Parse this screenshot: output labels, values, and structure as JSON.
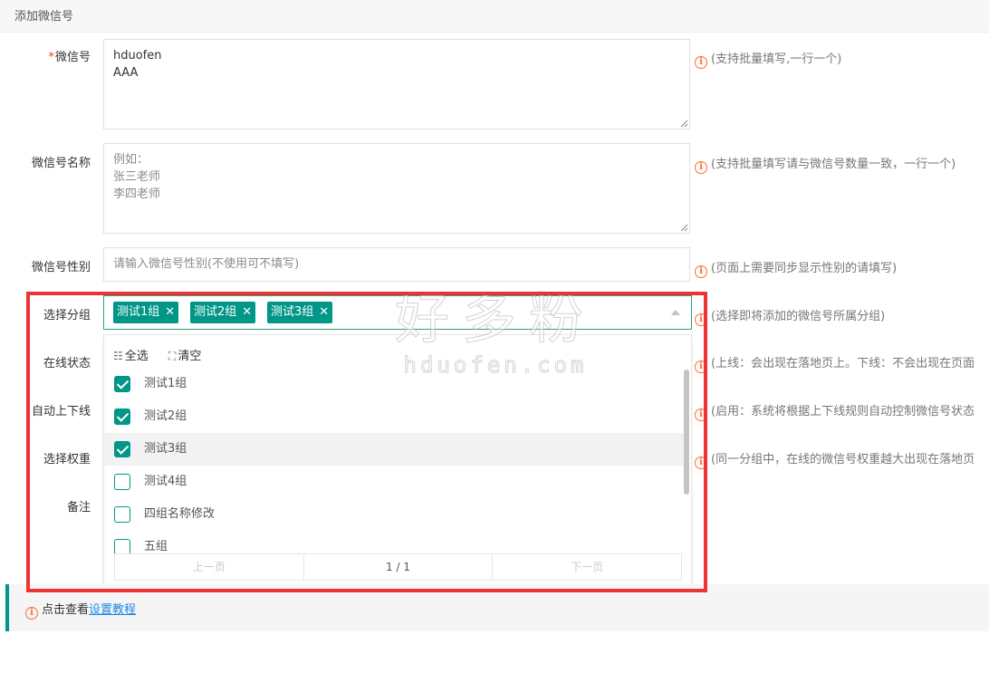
{
  "header": {
    "title": "添加微信号"
  },
  "form": {
    "wechat_id": {
      "required_mark": "*",
      "label": "微信号",
      "lines": [
        "hduofen",
        "AAA"
      ],
      "hint": "(支持批量填写,一行一个)"
    },
    "wechat_name": {
      "label": "微信号名称",
      "placeholder_lines": [
        "例如：",
        "张三老师",
        "李四老师"
      ],
      "hint": "(支持批量填写请与微信号数量一致，一行一个)"
    },
    "gender": {
      "label": "微信号性别",
      "placeholder": "请输入微信号性别(不使用可不填写)",
      "hint": "(页面上需要同步显示性别的请填写)"
    },
    "group": {
      "label": "选择分组",
      "selected_tags": [
        "测试1组",
        "测试2组",
        "测试3组"
      ],
      "hint": "(选择即将添加的微信号所属分组)"
    },
    "online_status": {
      "label": "在线状态",
      "hint": "(上线：会出现在落地页上。下线：不会出现在页面"
    },
    "auto_online": {
      "label": "自动上下线",
      "hint": "(启用：系统将根据上下线规则自动控制微信号状态"
    },
    "weight": {
      "label": "选择权重",
      "hint": "(同一分组中，在线的微信号权重越大出现在落地页"
    },
    "remark": {
      "label": "备注"
    }
  },
  "dropdown": {
    "select_all": "全选",
    "clear": "清空",
    "options": [
      {
        "label": "测试1组",
        "checked": true
      },
      {
        "label": "测试2组",
        "checked": true
      },
      {
        "label": "测试3组",
        "checked": true
      },
      {
        "label": "测试4组",
        "checked": false
      },
      {
        "label": "四组名称修改",
        "checked": false
      },
      {
        "label": "五组",
        "checked": false
      }
    ],
    "pager": {
      "prev": "上一页",
      "current": "1 / 1",
      "next": "下一页"
    }
  },
  "notice": {
    "text": "点击查看",
    "link": "设置教程"
  },
  "watermark": {
    "main": "好多粉",
    "sub": "hduofen.com"
  },
  "colors": {
    "accent": "#009688",
    "highlight": "#ec3436",
    "info": "#ff6a2b",
    "link": "#1e88e5"
  }
}
